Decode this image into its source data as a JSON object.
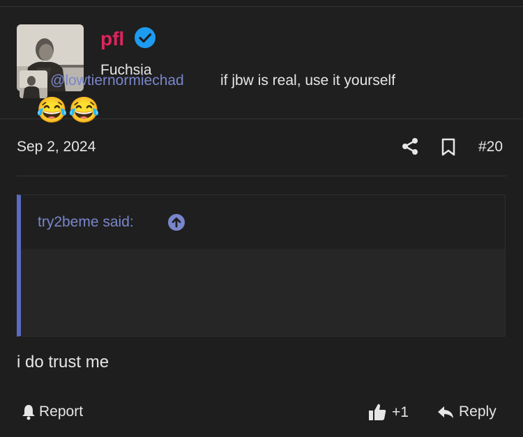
{
  "user": {
    "username": "pfl",
    "title": "Fuchsia",
    "verified_icon": "verified-check-icon",
    "username_color": "#e0245e"
  },
  "post": {
    "date": "Sep 2, 2024",
    "number": "#20",
    "body": "i do trust me"
  },
  "quote": {
    "attribution": "try2beme said:",
    "mention": "@lowtiernormiechad",
    "text": "if jbw is real, use it yourself",
    "emojis": [
      "😂",
      "😂"
    ],
    "accent_color": "#5c6bc0"
  },
  "actions": {
    "report_label": "Report",
    "like_count": "+1",
    "reply_label": "Reply"
  },
  "icons": {
    "share": "share-icon",
    "bookmark": "bookmark-icon",
    "report": "bell-icon",
    "like": "thumbs-up-icon",
    "reply": "reply-arrow-icon",
    "quote_jump": "arrow-up-circle-icon"
  }
}
